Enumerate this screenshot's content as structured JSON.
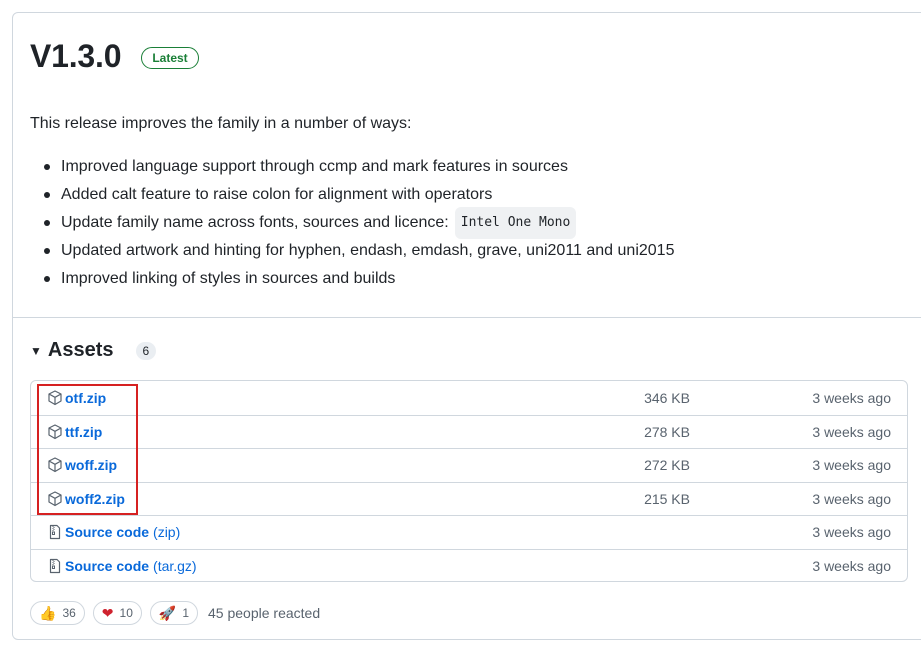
{
  "release": {
    "title": "V1.3.0",
    "badge": "Latest"
  },
  "notes": {
    "intro": "This release improves the family in a number of ways:",
    "items": [
      {
        "text": "Improved language support through ccmp and mark features in sources"
      },
      {
        "text": "Added calt feature to raise colon for alignment with operators"
      },
      {
        "text": "Update family name across fonts, sources and licence:",
        "code": "Intel One Mono"
      },
      {
        "text": "Updated artwork and hinting for hyphen, endash, emdash, grave, uni2011 and uni2015"
      },
      {
        "text": "Improved linking of styles in sources and builds"
      }
    ]
  },
  "assets": {
    "title": "Assets",
    "count": "6",
    "rows": [
      {
        "icon": "package-icon",
        "name": "otf.zip",
        "suffix": "",
        "size": "346 KB",
        "date": "3 weeks ago"
      },
      {
        "icon": "package-icon",
        "name": "ttf.zip",
        "suffix": "",
        "size": "278 KB",
        "date": "3 weeks ago"
      },
      {
        "icon": "package-icon",
        "name": "woff.zip",
        "suffix": "",
        "size": "272 KB",
        "date": "3 weeks ago"
      },
      {
        "icon": "package-icon",
        "name": "woff2.zip",
        "suffix": "",
        "size": "215 KB",
        "date": "3 weeks ago"
      },
      {
        "icon": "file-zip-icon",
        "name": "Source code",
        "suffix": "(zip)",
        "size": "",
        "date": "3 weeks ago"
      },
      {
        "icon": "file-zip-icon",
        "name": "Source code",
        "suffix": "(tar.gz)",
        "size": "",
        "date": "3 weeks ago"
      }
    ]
  },
  "reactions": {
    "items": [
      {
        "icon": "thumbs-up-icon",
        "emoji": "👍",
        "count": "36"
      },
      {
        "icon": "heart-icon",
        "emoji": "❤",
        "count": "10"
      },
      {
        "icon": "rocket-icon",
        "emoji": "🚀",
        "count": "1"
      }
    ],
    "summary": "45 people reacted"
  },
  "colors": {
    "accent_link": "#0969da",
    "latest_green": "#1a7f37",
    "highlight_red": "#d62121"
  }
}
